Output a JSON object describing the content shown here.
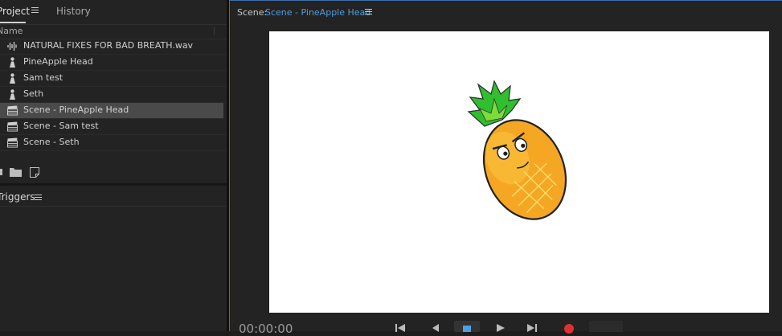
{
  "project_panel": {
    "tab_project": "Project",
    "tab_history": "History",
    "column_name": "Name",
    "items": [
      {
        "label": "NATURAL FIXES FOR BAD BREATH.wav",
        "icon": "audio-icon"
      },
      {
        "label": "PineApple Head",
        "icon": "puppet-icon"
      },
      {
        "label": "Sam test",
        "icon": "puppet-icon"
      },
      {
        "label": "Seth",
        "icon": "puppet-icon"
      },
      {
        "label": "Scene - PineApple Head",
        "icon": "clapperboard-icon",
        "selected": true
      },
      {
        "label": "Scene - Sam test",
        "icon": "clapperboard-icon"
      },
      {
        "label": "Scene - Seth",
        "icon": "clapperboard-icon"
      }
    ]
  },
  "triggers_panel": {
    "title": "Triggers"
  },
  "scene_panel": {
    "label": "Scene:",
    "name": "Scene - PineApple Head"
  },
  "transport": {
    "timecode": "00:00:00"
  },
  "colors": {
    "accent": "#4d9de0",
    "record": "#e03030"
  }
}
